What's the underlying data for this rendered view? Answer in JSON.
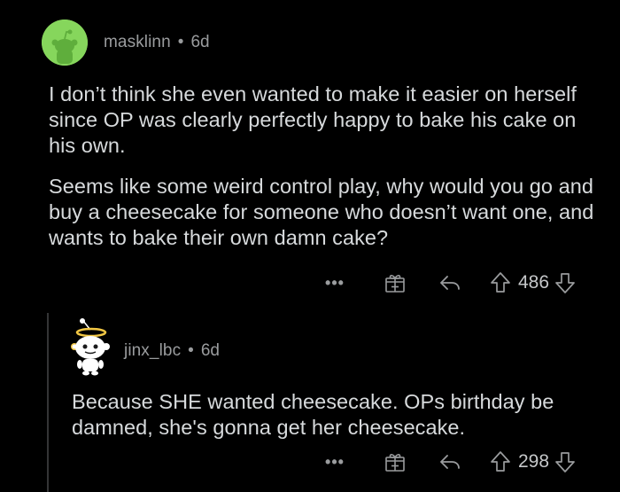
{
  "comments": [
    {
      "username": "masklinn",
      "separator": "•",
      "age": "6d",
      "avatar_color": "#86d65c",
      "paragraphs": [
        "I don’t think she even wanted to make it easier on herself since OP was clearly perfectly happy to bake his cake on his own.",
        "Seems like some weird control play, why would you go and buy a cheesecake for someone who doesn’t want one, and wants to bake their own damn cake?"
      ],
      "actions": {
        "more_label": "•••",
        "score": "486",
        "icons": [
          "more-icon",
          "gift-icon",
          "reply-icon",
          "upvote-icon",
          "downvote-icon"
        ]
      }
    },
    {
      "username": "jinx_lbc",
      "separator": "•",
      "age": "6d",
      "paragraphs": [
        "Because SHE wanted cheesecake. OPs birthday be damned, she's gonna get her cheesecake."
      ],
      "actions": {
        "more_label": "•••",
        "score": "298",
        "icons": [
          "more-icon",
          "gift-icon",
          "reply-icon",
          "upvote-icon",
          "downvote-icon"
        ]
      }
    }
  ],
  "colors": {
    "background": "#000000",
    "text": "#d7dadc",
    "meta": "#9a9c9e",
    "thread_line": "#343536"
  }
}
